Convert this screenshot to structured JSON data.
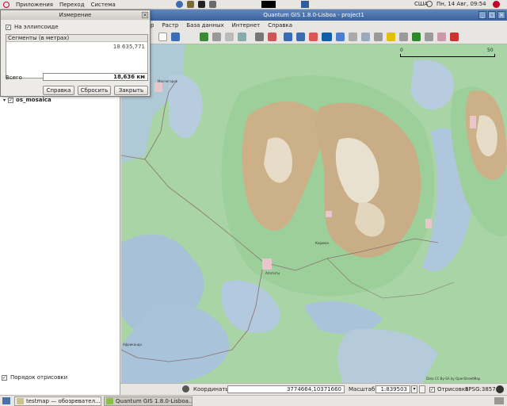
{
  "top_panel": {
    "menus": [
      "Приложения",
      "Переход",
      "Система"
    ],
    "locale": "США",
    "datetime": "Пн, 14 Авг, 09:54"
  },
  "window": {
    "title": "Quantum GIS 1.8.0-Lisboa - project1"
  },
  "menubar": {
    "items": [
      "р",
      "Растр",
      "База данных",
      "Интернет",
      "Справка"
    ]
  },
  "layers": {
    "layer_name": "os_mosaica",
    "render_order_label": "Порядок отрисовки"
  },
  "measure_dialog": {
    "title": "Измерение",
    "ellipsoid_label": "На эллипсоиде",
    "segments_header": "Сегменты (в метрах)",
    "segment_value": "18 635,771",
    "total_label": "Всего",
    "total_value": "18,636 км",
    "help_button": "Справка",
    "reset_button": "Сбросить",
    "close_button": "Закрыть"
  },
  "map": {
    "scale_labels": [
      "0",
      "50"
    ],
    "attribution": "Data CC-By-SA by OpenStreetMap",
    "place_labels": [
      "Мончегорск",
      "Кировск",
      "Апатиты",
      "Африканда"
    ],
    "colors": {
      "forest": "#a9d4a6",
      "water": "#b0c8de",
      "mountain": "#cbb088",
      "road": "#8a6f6f"
    }
  },
  "statusbar": {
    "coords_label": "Координаты:",
    "coords_value": "3774664,10371660",
    "scale_label": "Масштаб",
    "scale_value": "1:839503",
    "render_label": "Отрисовка",
    "epsg": "EPSG:3857"
  },
  "taskbar": {
    "items": [
      "testmap — обозревател...",
      "Quantum GIS 1.8.0-Lisboa..."
    ]
  }
}
